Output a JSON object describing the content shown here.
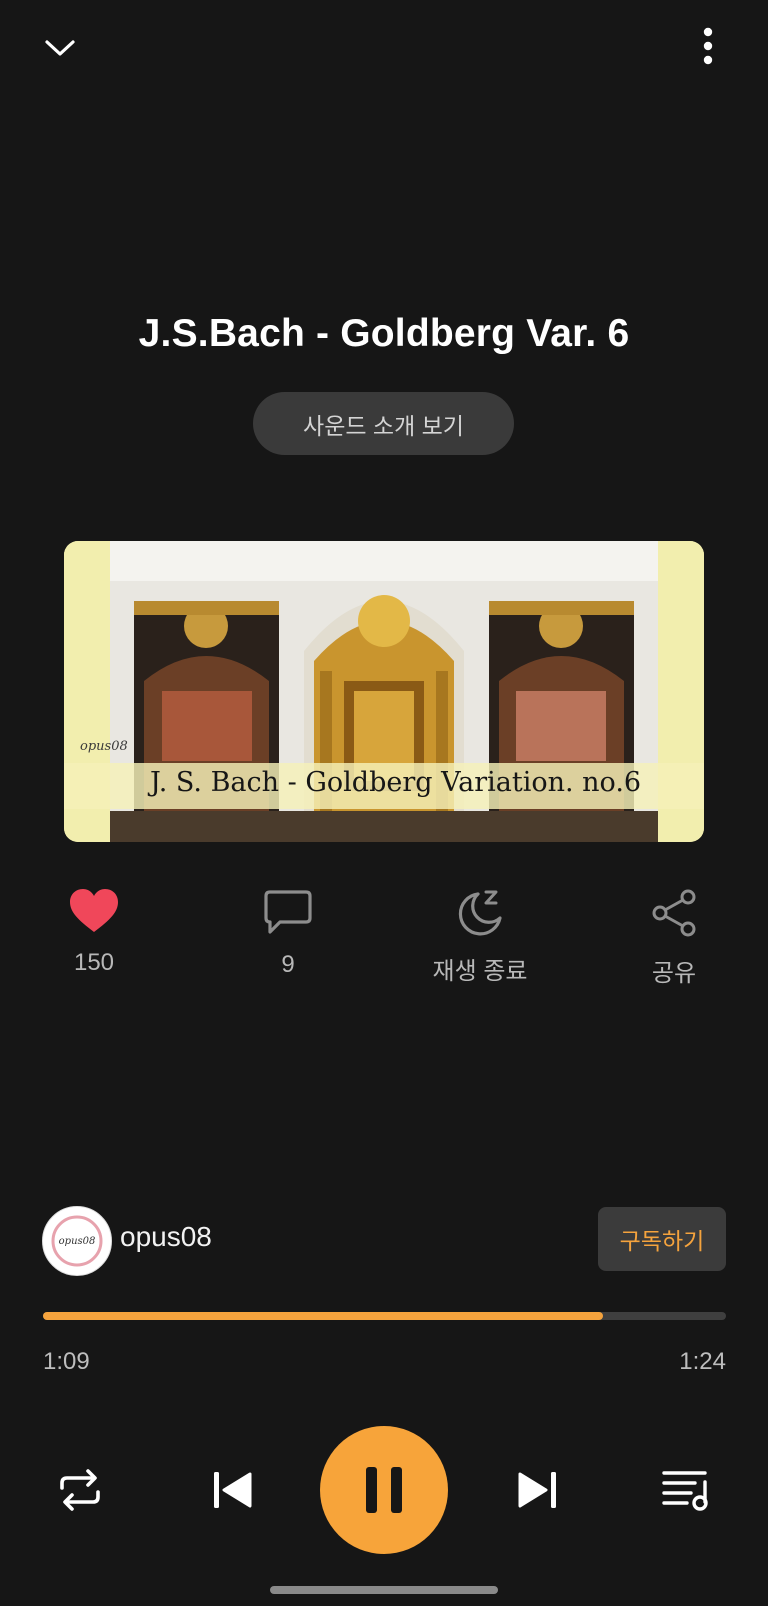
{
  "header": {
    "collapse_icon": "chevron-down-icon",
    "menu_icon": "more-vertical-icon"
  },
  "track": {
    "title": "J.S.Bach - Goldberg Var. 6",
    "intro_button": "사운드 소개 보기"
  },
  "cover": {
    "watermark": "opus08",
    "caption": "J. S. Bach - Goldberg Variation. no.6"
  },
  "actions": [
    {
      "icon": "heart-icon",
      "label": "150"
    },
    {
      "icon": "comment-icon",
      "label": "9"
    },
    {
      "icon": "sleep-timer-icon",
      "label": "재생 종료"
    },
    {
      "icon": "share-icon",
      "label": "공유"
    }
  ],
  "channel": {
    "name": "opus08",
    "avatar_text": "opus08",
    "subscribe_label": "구독하기"
  },
  "playback": {
    "elapsed": "1:09",
    "duration": "1:24",
    "progress": 0.82
  },
  "controls": {
    "repeat_icon": "repeat-icon",
    "prev_icon": "skip-previous-icon",
    "pause_icon": "pause-icon",
    "next_icon": "skip-next-icon",
    "playlist_icon": "playlist-icon"
  },
  "colors": {
    "background": "#161616",
    "accent": "#f5a33d",
    "heart": "#f0475a"
  }
}
